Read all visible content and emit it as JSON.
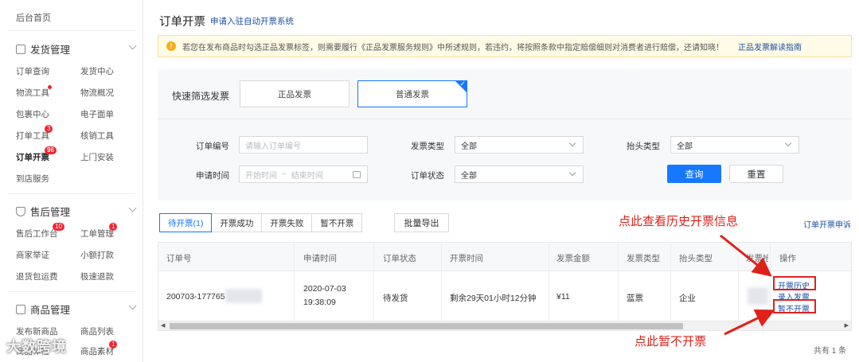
{
  "sidebar": {
    "home": "后台首页",
    "groups": [
      {
        "title": "发货管理",
        "icon": "document-icon"
      },
      {
        "title": "售后管理",
        "icon": "shield-icon"
      },
      {
        "title": "商品管理",
        "icon": "box-icon"
      }
    ],
    "shipping_items": [
      "订单查询",
      "发货中心",
      "物流工具",
      "物流概况",
      "包裹中心",
      "电子面单",
      "打单工具",
      "核销工具",
      "订单开票",
      "上门安装",
      "到店服务"
    ],
    "aftersale_items": [
      "售后工作台",
      "工单管理",
      "商家举证",
      "小额打款",
      "退货包运费",
      "极速退款"
    ],
    "product_items": [
      "发布新商品",
      "商品列表",
      "商品体检",
      "商品素材"
    ],
    "badges": {
      "print_tool": "3",
      "invoice": "96",
      "workbench": "10",
      "ticket": "1",
      "material": "1"
    },
    "watermark": "大数跨境"
  },
  "header": {
    "title": "订单开票",
    "link": "申请入驻自动开票系统"
  },
  "notice": {
    "icon": "warning-icon",
    "text": "若您在发布商品时勾选正品发票标签，则需要履行《正品发票服务规则》中所述规则，若违约，将按照条款中指定赔偿细则对消费者进行赔偿，还请知晓！",
    "link": "正品发票解读指南"
  },
  "quick_filter": {
    "label": "快速筛选发票",
    "options": [
      "正品发票",
      "普通发票"
    ],
    "selected": "普通发票"
  },
  "filters": {
    "order_no_label": "订单编号",
    "order_no_placeholder": "请输入订单编号",
    "invoice_type_label": "发票类型",
    "invoice_type_value": "全部",
    "title_type_label": "抬头类型",
    "title_type_value": "全部",
    "apply_time_label": "申请时间",
    "start_placeholder": "开始时间",
    "range_sep": "~",
    "end_placeholder": "结束时间",
    "order_status_label": "订单状态",
    "order_status_value": "全部",
    "query_button": "查询",
    "reset_button": "重置"
  },
  "tabs": [
    "待开票(1)",
    "开票成功",
    "开票失败",
    "暂不开票"
  ],
  "export_button": "批量导出",
  "right_link": "订单开票申诉",
  "table": {
    "columns": [
      "订单号",
      "申请时间",
      "订单状态",
      "开票时间",
      "发票金额",
      "发票类型",
      "抬头类型",
      "发票抬",
      "操作"
    ],
    "row": {
      "order_no": "200703-177765",
      "apply_date": "2020-07-03",
      "apply_time": "19:38:09",
      "status": "待发货",
      "invoice_time": "剩余29天01小时12分钟",
      "amount": "¥11",
      "invoice_type": "蓝票",
      "title_type": "企业",
      "actions": [
        "开票历史",
        "录入发票",
        "暂不开票"
      ]
    },
    "total": "共有 1 条"
  },
  "annotations": {
    "history": "点此查看历史开票信息",
    "skip": "点此暂不开票",
    "color": "#e0201a"
  }
}
